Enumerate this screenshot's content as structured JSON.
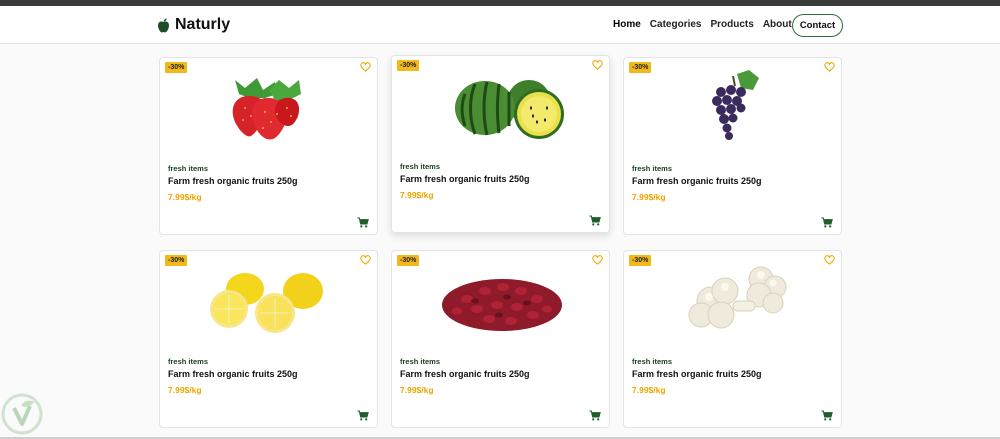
{
  "brand": {
    "name": "Naturly",
    "icon": "apple-icon"
  },
  "nav": {
    "items": [
      "Home",
      "Categories",
      "Products",
      "About Us"
    ],
    "contact": "Contact"
  },
  "products": [
    {
      "badge": "-30%",
      "category": "fresh items",
      "title": "Farm fresh organic fruits 250g",
      "price": "7.99$/kg",
      "image": "strawberries"
    },
    {
      "badge": "-30%",
      "category": "fresh items",
      "title": "Farm fresh organic fruits 250g",
      "price": "7.99$/kg",
      "image": "watermelon"
    },
    {
      "badge": "-30%",
      "category": "fresh items",
      "title": "Farm fresh organic fruits 250g",
      "price": "7.99$/kg",
      "image": "grapes"
    },
    {
      "badge": "-30%",
      "category": "fresh items",
      "title": "Farm fresh organic fruits 250g",
      "price": "7.99$/kg",
      "image": "lemons"
    },
    {
      "badge": "-30%",
      "category": "fresh items",
      "title": "Farm fresh organic fruits 250g",
      "price": "7.99$/kg",
      "image": "cranberries"
    },
    {
      "badge": "-30%",
      "category": "fresh items",
      "title": "Farm fresh organic fruits 250g",
      "price": "7.99$/kg",
      "image": "cauliflower"
    }
  ],
  "colors": {
    "accent": "#f3b81a",
    "price": "#f0a500",
    "brand_green": "#2f6f3a",
    "cart": "#1f5d2a"
  }
}
